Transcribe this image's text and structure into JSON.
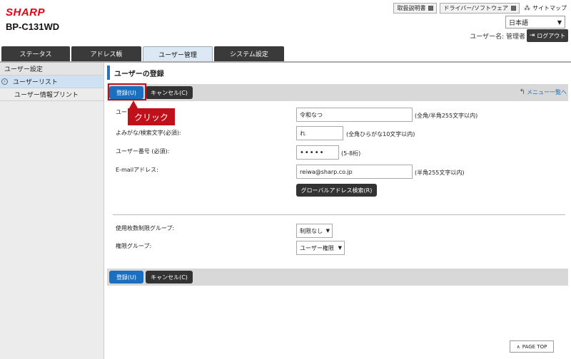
{
  "header": {
    "brand": "SHARP",
    "model": "BP-C131WD",
    "links": [
      "取扱説明書",
      "ドライバー/ソフトウェア"
    ],
    "sitemap": "サイトマップ",
    "language": "日本語",
    "user_label": "ユーザー名: 管理者",
    "logout": "ログアウト"
  },
  "tabs": [
    "ステータス",
    "アドレス帳",
    "ユーザー管理",
    "システム設定"
  ],
  "sidebar": {
    "heading": "ユーザー設定",
    "items": [
      "ユーザーリスト",
      "ユーザー情報プリント"
    ]
  },
  "page": {
    "title": "ユーザーの登録"
  },
  "buttons": {
    "register": "登録(U)",
    "cancel": "キャンセル(C)",
    "menu_link": "メニュー一覧へ",
    "global_search": "グローバルアドレス検索(R)",
    "page_top": "PAGE TOP"
  },
  "callout": "クリック",
  "form": {
    "user_name": {
      "label": "ユーザー名 (必須):",
      "label_visible": "ユー",
      "value": "令和なつ",
      "hint": "(全角/半角255文字以内)"
    },
    "reading": {
      "label": "よみがな/検索文字(必須):",
      "value": "れ",
      "hint": "(全角ひらがな10文字以内)"
    },
    "user_number": {
      "label": "ユーザー番号 (必須):",
      "value": "•••••",
      "hint": "(5-8桁)"
    },
    "email": {
      "label": "E-mailアドレス:",
      "value": "reiwa@sharp.co.jp",
      "hint": "(半角255文字以内)"
    },
    "usage_group": {
      "label": "使用枚数制限グループ:",
      "value": "制限なし"
    },
    "auth_group": {
      "label": "権限グループ:",
      "value": "ユーザー権限"
    }
  },
  "icons": {
    "external": "external-link-icon",
    "sitemap": "sitemap-icon",
    "logout": "logout-icon",
    "menu": "return-arrow-icon"
  },
  "colors": {
    "brand": "#e60012",
    "primary": "#1a6fc0",
    "dark": "#333333",
    "highlight": "#c0101a"
  }
}
